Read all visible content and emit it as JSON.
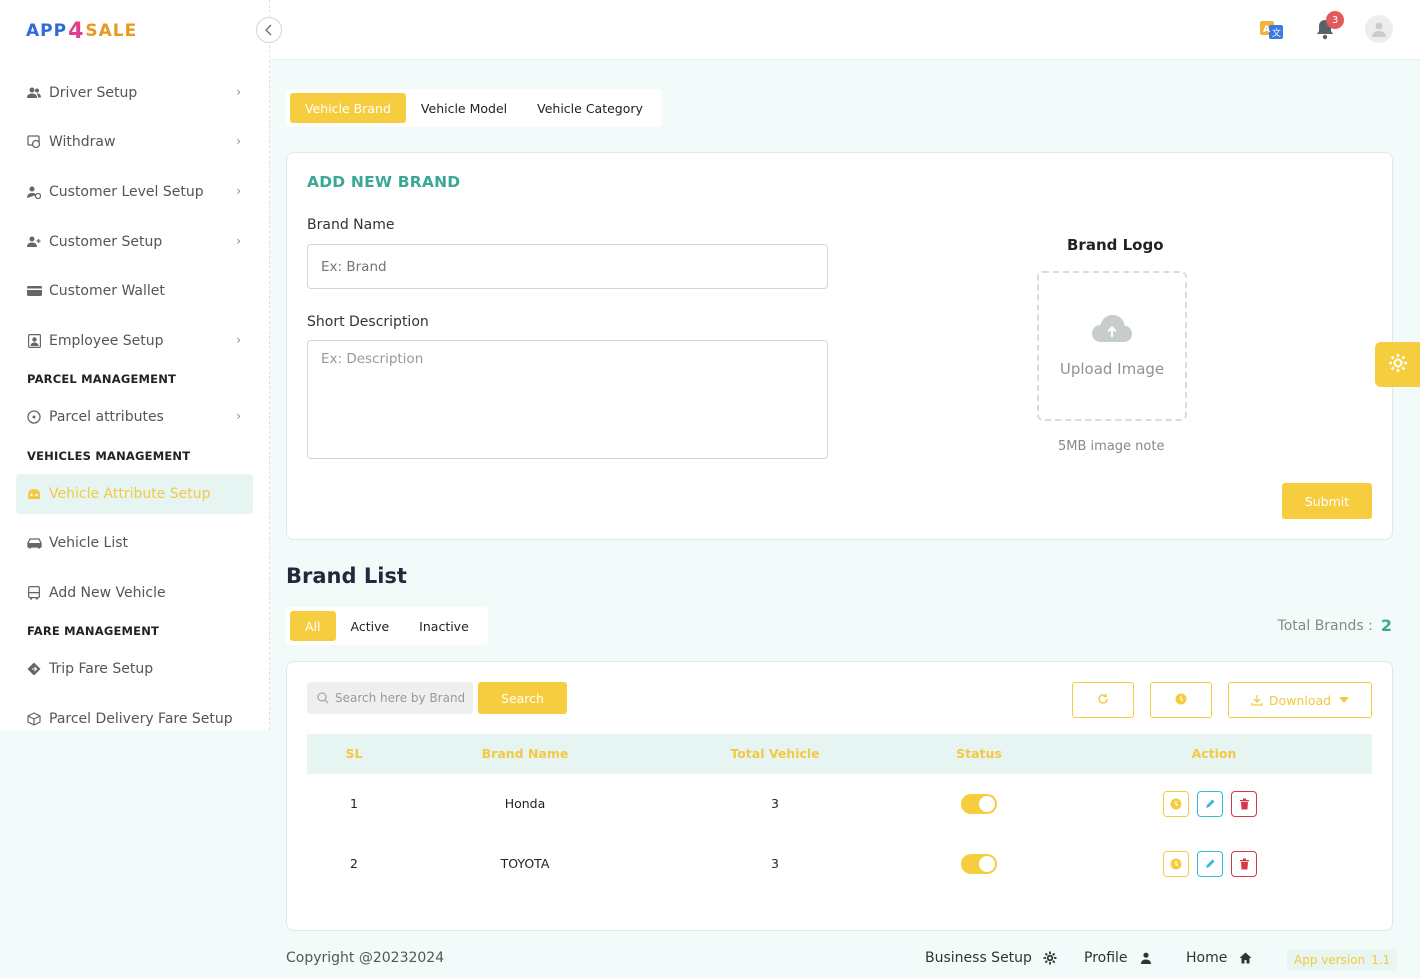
{
  "logo": {
    "part1": "APP",
    "part2": "4",
    "part3": "SALE"
  },
  "sidebar": {
    "items": [
      {
        "label": "Driver Setup",
        "icon": "users-icon"
      },
      {
        "label": "Withdraw",
        "icon": "withdraw-icon"
      },
      {
        "label": "Customer Level Setup",
        "icon": "user-level-icon"
      },
      {
        "label": "Customer Setup",
        "icon": "user-plus-icon"
      },
      {
        "label": "Customer Wallet",
        "icon": "wallet-icon"
      },
      {
        "label": "Employee Setup",
        "icon": "id-card-icon"
      },
      {
        "label": "Parcel attributes",
        "icon": "parcel-icon"
      },
      {
        "label": "Vehicle Attribute Setup",
        "icon": "vehicle-attr-icon"
      },
      {
        "label": "Vehicle List",
        "icon": "car-icon"
      },
      {
        "label": "Add New Vehicle",
        "icon": "bus-icon"
      },
      {
        "label": "Trip Fare Setup",
        "icon": "diamond-icon"
      },
      {
        "label": "Parcel Delivery Fare Setup",
        "icon": "box-icon"
      }
    ],
    "sections": {
      "parcel": "PARCEL MANAGEMENT",
      "vehicles": "VEHICLES MANAGEMENT",
      "fare": "FARE MANAGEMENT"
    }
  },
  "header": {
    "notification_count": "3"
  },
  "tabs": [
    "Vehicle Brand",
    "Vehicle Model",
    "Vehicle Category"
  ],
  "form": {
    "title": "ADD NEW BRAND",
    "brand_name_label": "Brand Name",
    "brand_name_placeholder": "Ex: Brand",
    "desc_label": "Short Description",
    "desc_placeholder": "Ex: Description",
    "logo_label": "Brand Logo",
    "upload_text": "Upload Image",
    "image_note": "5MB image note",
    "submit": "Submit"
  },
  "list": {
    "title": "Brand List",
    "filters": [
      "All",
      "Active",
      "Inactive"
    ],
    "total_label": "Total Brands :",
    "total_value": "2",
    "search_placeholder": "Search here by Brand",
    "search_button": "Search",
    "download": "Download",
    "columns": [
      "SL",
      "Brand Name",
      "Total Vehicle",
      "Status",
      "Action"
    ],
    "rows": [
      {
        "sl": "1",
        "brand": "Honda",
        "total": "3"
      },
      {
        "sl": "2",
        "brand": "TOYOTA",
        "total": "3"
      }
    ]
  },
  "footer": {
    "copyright": "Copyright @20232024",
    "business": "Business Setup",
    "profile": "Profile",
    "home": "Home",
    "version_label": "App version",
    "version_value": "1.1"
  },
  "colors": {
    "accent": "#f6cd3f",
    "teal": "#3aa896",
    "danger": "#d9364a"
  }
}
